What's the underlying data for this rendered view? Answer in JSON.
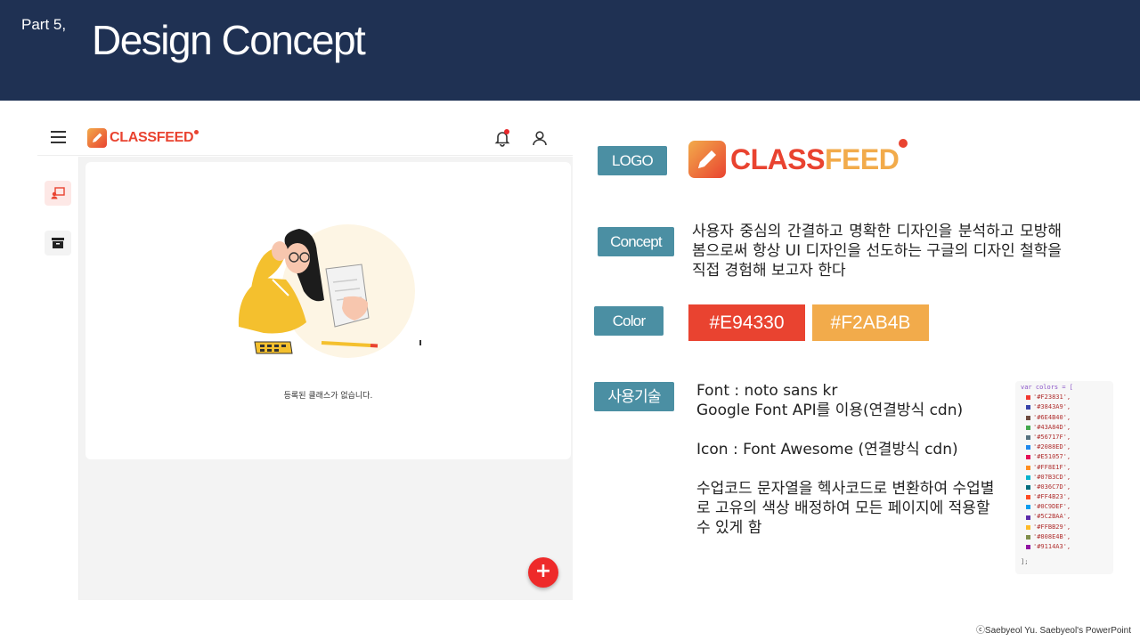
{
  "header": {
    "part": "Part 5,",
    "title": "Design Concept"
  },
  "app_mock": {
    "logo_text": "CLASSFEED",
    "empty_message": "등록된 클래스가 없습니다.",
    "fab_label": "+"
  },
  "sections": {
    "logo_label": "LOGO",
    "logo_text_a": "CLASS",
    "logo_text_b": "FEED",
    "concept_label": "Concept",
    "concept_text": "사용자 중심의 간결하고 명확한 디자인을 분석하고 모방해 봄으로써 항상 UI 디자인을 선도하는 구글의 디자인 철학을 직접 경험해 보고자 한다",
    "color_label": "Color",
    "color_1": "#E94330",
    "color_2": "#F2AB4B",
    "tech_label": "사용기술",
    "tech_line_1": "Font : noto sans kr",
    "tech_line_2": "Google Font API를 이용(연결방식 cdn)",
    "tech_line_3": "Icon : Font Awesome (연결방식 cdn)",
    "tech_line_4": "수업코드 문자열을 헥사코드로 변환하여 수업별로 고유의 색상 배정하여 모든 페이지에 적용할 수 있게 함"
  },
  "code_snippet": {
    "head": "var colors = [",
    "tail": "];",
    "colors": [
      "#F23831",
      "#3843A9",
      "#6E4B40",
      "#43A84D",
      "#56717F",
      "#2088ED",
      "#E51057",
      "#FF8E1F",
      "#07B3CD",
      "#036C7D",
      "#FF4B23",
      "#0C9DEF",
      "#5C2BAA",
      "#FFBB29",
      "#808E4B",
      "#9114A3"
    ]
  },
  "footer": "ⓒSaebyeol Yu. Saebyeol's PowerPoint",
  "theme": {
    "header_bg": "#1f3153",
    "pill_bg": "#4b8fa3",
    "accent_red": "#E94330",
    "accent_orange": "#F2AB4B"
  }
}
